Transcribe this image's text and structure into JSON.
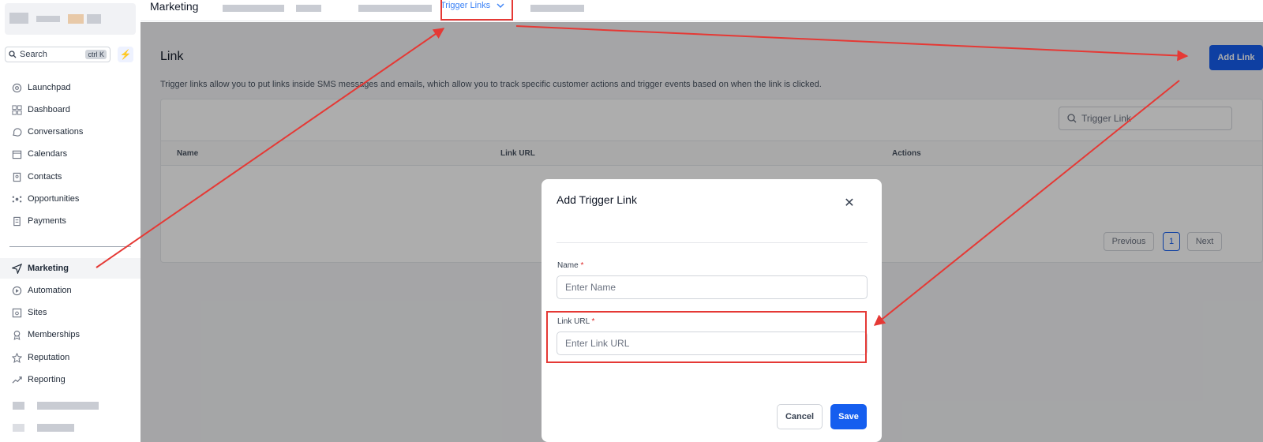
{
  "sidebar": {
    "search_label": "Search",
    "search_shortcut": "ctrl K",
    "items": [
      {
        "label": "Launchpad",
        "icon": "launchpad-icon"
      },
      {
        "label": "Dashboard",
        "icon": "dashboard-icon"
      },
      {
        "label": "Conversations",
        "icon": "chat-bubble-icon"
      },
      {
        "label": "Calendars",
        "icon": "calendar-icon"
      },
      {
        "label": "Contacts",
        "icon": "contacts-icon"
      },
      {
        "label": "Opportunities",
        "icon": "opportunities-icon"
      },
      {
        "label": "Payments",
        "icon": "payments-icon"
      },
      {
        "label": "Marketing",
        "icon": "send-icon",
        "active": true
      },
      {
        "label": "Automation",
        "icon": "automation-icon"
      },
      {
        "label": "Sites",
        "icon": "sites-icon"
      },
      {
        "label": "Memberships",
        "icon": "membership-icon"
      },
      {
        "label": "Reputation",
        "icon": "star-icon"
      },
      {
        "label": "Reporting",
        "icon": "trend-icon"
      }
    ]
  },
  "topbar": {
    "title": "Marketing",
    "active_tab": "Trigger Links"
  },
  "main": {
    "page_title": "Link",
    "description": "Trigger links allow you to put links inside SMS messages and emails, which allow you to track specific customer actions and trigger events based on when the link is clicked.",
    "add_button": "Add Link",
    "search_placeholder": "Trigger Link",
    "columns": [
      "Name",
      "Link URL",
      "Actions"
    ],
    "pagination": {
      "previous": "Previous",
      "current": "1",
      "next": "Next"
    }
  },
  "modal": {
    "title": "Add Trigger Link",
    "name_label": "Name",
    "name_placeholder": "Enter Name",
    "url_label": "Link URL",
    "url_placeholder": "Enter Link URL",
    "required_mark": "*",
    "cancel": "Cancel",
    "save": "Save"
  },
  "colors": {
    "primary": "#155eef",
    "annotation": "#e53935"
  }
}
